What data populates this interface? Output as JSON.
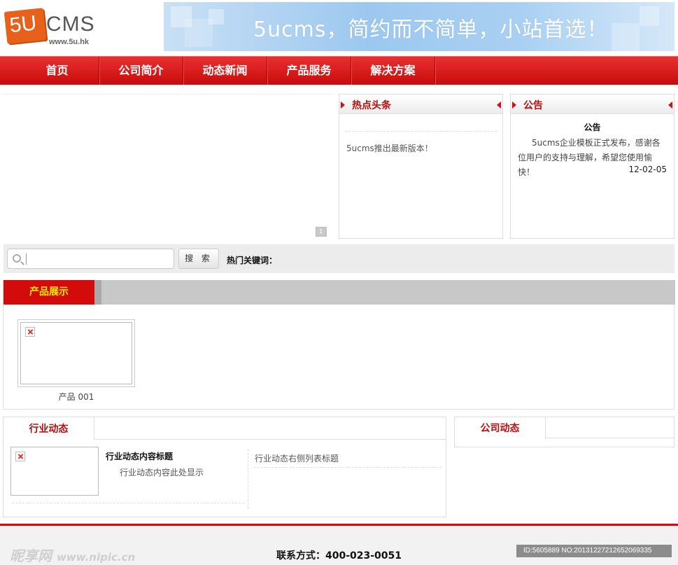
{
  "header": {
    "logo_mark": "5U",
    "logo_text": "CMS",
    "logo_url": "www.5u.hk",
    "banner_slogan": "5ucms，简约而不简单，小站首选！"
  },
  "nav": {
    "items": [
      {
        "label": "首页"
      },
      {
        "label": "公司简介"
      },
      {
        "label": "动态新闻"
      },
      {
        "label": "产品服务"
      },
      {
        "label": "解决方案"
      }
    ]
  },
  "hot": {
    "title": "热点头条",
    "items": [
      "5ucms推出最新版本！"
    ]
  },
  "notice": {
    "title": "公告",
    "heading": "公告",
    "text": "5ucms企业模板正式发布，感谢各位用户的支持与理解，希望您使用愉快！",
    "date": "12-02-05"
  },
  "search": {
    "placeholder": "",
    "button_label": "搜 索",
    "hot_keywords_label": "热门关键词："
  },
  "products": {
    "title": "产品展示",
    "items": [
      {
        "name": "产品 001"
      }
    ]
  },
  "industry": {
    "title": "行业动态",
    "featured_title": "行业动态内容标题",
    "featured_desc": "行业动态内容此处显示",
    "list": [
      "行业动态右侧列表标题"
    ]
  },
  "company": {
    "title": "公司动态"
  },
  "footer": {
    "contact": "联系方式：400-023-0051",
    "watermark_cn": "昵享网",
    "watermark_url": "www.nipic.cn",
    "image_id": "ID:5605889 NO:20131227212652069335"
  },
  "colors": {
    "brand_red": "#d30b0b",
    "product_tab_text": "#ffe800",
    "logo_orange": "#e8611a"
  }
}
